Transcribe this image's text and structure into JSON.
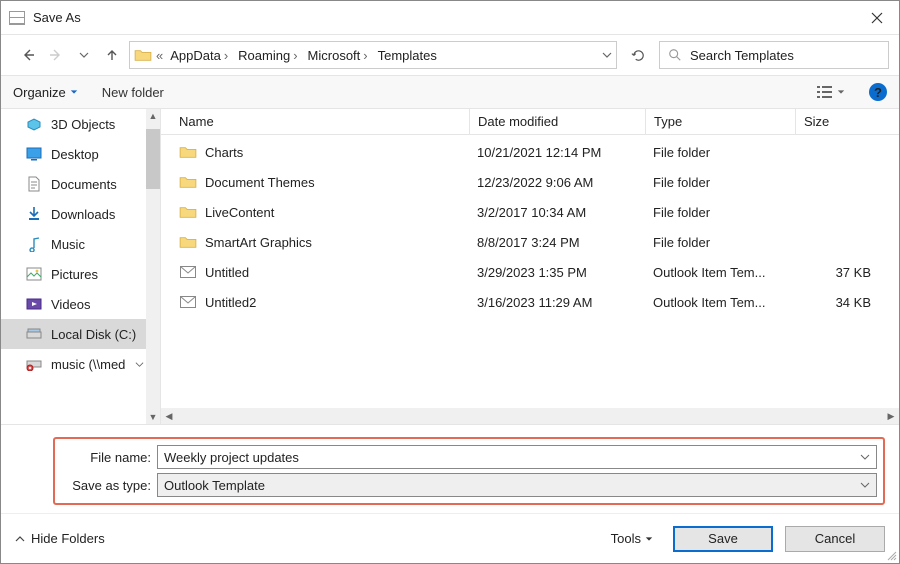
{
  "title": "Save As",
  "breadcrumbs": {
    "prefix": "«",
    "b0": "AppData",
    "b1": "Roaming",
    "b2": "Microsoft",
    "b3": "Templates"
  },
  "search": {
    "placeholder": "Search Templates"
  },
  "toolbar": {
    "organize": "Organize",
    "newfolder": "New folder"
  },
  "columns": {
    "name": "Name",
    "date": "Date modified",
    "type": "Type",
    "size": "Size"
  },
  "side": {
    "i0": "3D Objects",
    "i1": "Desktop",
    "i2": "Documents",
    "i3": "Downloads",
    "i4": "Music",
    "i5": "Pictures",
    "i6": "Videos",
    "i7": "Local Disk (C:)",
    "i8": "music (\\\\med"
  },
  "rows": [
    {
      "name": "Charts",
      "date": "10/21/2021 12:14 PM",
      "type": "File folder",
      "size": "",
      "kind": "folder"
    },
    {
      "name": "Document Themes",
      "date": "12/23/2022 9:06 AM",
      "type": "File folder",
      "size": "",
      "kind": "folder"
    },
    {
      "name": "LiveContent",
      "date": "3/2/2017 10:34 AM",
      "type": "File folder",
      "size": "",
      "kind": "folder"
    },
    {
      "name": "SmartArt Graphics",
      "date": "8/8/2017 3:24 PM",
      "type": "File folder",
      "size": "",
      "kind": "folder"
    },
    {
      "name": "Untitled",
      "date": "3/29/2023 1:35 PM",
      "type": "Outlook Item Tem...",
      "size": "37 KB",
      "kind": "mail"
    },
    {
      "name": "Untitled2",
      "date": "3/16/2023 11:29 AM",
      "type": "Outlook Item Tem...",
      "size": "34 KB",
      "kind": "mail"
    }
  ],
  "form": {
    "filename_label": "File name:",
    "filename_value": "Weekly project updates",
    "type_label": "Save as type:",
    "type_value": "Outlook Template"
  },
  "footer": {
    "hide": "Hide Folders",
    "tools": "Tools",
    "save": "Save",
    "cancel": "Cancel"
  }
}
